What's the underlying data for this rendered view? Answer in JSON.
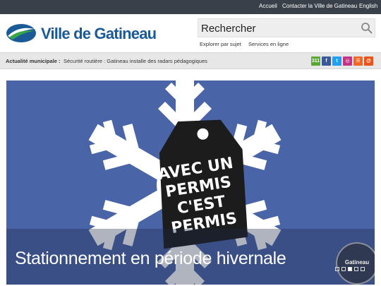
{
  "topnav": {
    "links": [
      "Accueil",
      "Contacter la Ville de Gatineau",
      "English"
    ]
  },
  "header": {
    "logo_text": "Ville de Gatineau",
    "search_placeholder": "Rechercher",
    "links": [
      "Explorer par sujet",
      "Services en ligne"
    ]
  },
  "newsbar": {
    "label": "Actualité municipale :",
    "text": "Sécurité routière : Gatineau installe des radars pédagogiques"
  },
  "social": [
    {
      "name": "311",
      "color": "#5aa732"
    },
    {
      "name": "facebook",
      "color": "#3b5998"
    },
    {
      "name": "twitter",
      "color": "#1da1f2"
    },
    {
      "name": "instagram",
      "color": "#c13584"
    },
    {
      "name": "rss",
      "color": "#f26522"
    },
    {
      "name": "email",
      "color": "#e8541c"
    }
  ],
  "hero": {
    "title": "Stationnement en période hivernale",
    "tag_lines": [
      "AVEC UN",
      "PERMIS",
      "C'EST",
      "PERMIS"
    ],
    "badge": "Gatineau",
    "slides_count": 5,
    "active_slide": 3
  },
  "colors": {
    "topbar": "#3a4049",
    "brand_blue": "#1a5a96",
    "brand_green": "#3aa546",
    "hero_bg": "#4a64a8"
  }
}
